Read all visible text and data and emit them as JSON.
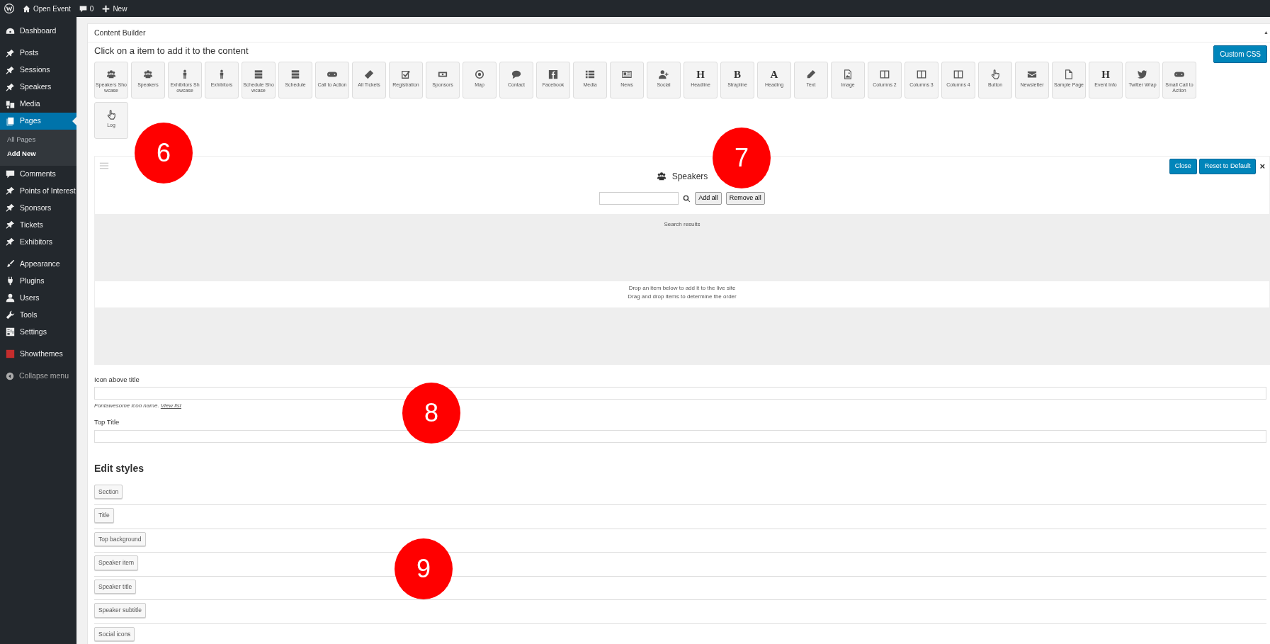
{
  "admin_bar": {
    "site": "Open Event",
    "comments": "0",
    "new": "New"
  },
  "sidebar": {
    "groups": [
      {
        "items": [
          {
            "label": "Dashboard",
            "selected": false
          }
        ]
      },
      {
        "items": [
          {
            "label": "Posts",
            "selected": false
          },
          {
            "label": "Sessions",
            "selected": false
          },
          {
            "label": "Speakers",
            "selected": false
          },
          {
            "label": "Media",
            "selected": false
          },
          {
            "label": "Pages",
            "selected": true,
            "children": [
              {
                "label": "All Pages",
                "selected": false
              },
              {
                "label": "Add New",
                "selected": true
              }
            ]
          },
          {
            "label": "Comments",
            "selected": false
          },
          {
            "label": "Points of Interest",
            "selected": false
          },
          {
            "label": "Sponsors",
            "selected": false
          },
          {
            "label": "Tickets",
            "selected": false
          },
          {
            "label": "Exhibitors",
            "selected": false
          }
        ]
      },
      {
        "items": [
          {
            "label": "Appearance",
            "selected": false
          },
          {
            "label": "Plugins",
            "selected": false
          },
          {
            "label": "Users",
            "selected": false
          },
          {
            "label": "Tools",
            "selected": false
          },
          {
            "label": "Settings",
            "selected": false
          }
        ]
      },
      {
        "items": [
          {
            "label": "Showthemes",
            "selected": false
          }
        ]
      }
    ],
    "collapse": "Collapse menu"
  },
  "content_builder": {
    "title": "Content Builder",
    "toggle": "▲",
    "instruction": "Click on a item to add it to the content",
    "custom_css": "Custom CSS",
    "items": [
      {
        "label": "Speakers Showcase"
      },
      {
        "label": "Speakers"
      },
      {
        "label": "Exhibitors Showcase"
      },
      {
        "label": "Exhibitors"
      },
      {
        "label": "Schedule Showcase"
      },
      {
        "label": "Schedule"
      },
      {
        "label": "Call to Action"
      },
      {
        "label": "All Tickets"
      },
      {
        "label": "Registration"
      },
      {
        "label": "Sponsors"
      },
      {
        "label": "Map"
      },
      {
        "label": "Contact"
      },
      {
        "label": "Facebook"
      },
      {
        "label": "Media"
      },
      {
        "label": "News"
      },
      {
        "label": "Social"
      },
      {
        "label": "Headline",
        "glyph": "H"
      },
      {
        "label": "Strapline",
        "glyph": "B"
      },
      {
        "label": "Heading",
        "glyph": "A"
      },
      {
        "label": "Text"
      },
      {
        "label": "Image"
      },
      {
        "label": "Columns 2"
      },
      {
        "label": "Columns 3"
      },
      {
        "label": "Columns 4"
      },
      {
        "label": "Button"
      },
      {
        "label": "Newsletter"
      },
      {
        "label": "Sample Page"
      },
      {
        "label": "Event Info",
        "glyph": "H"
      },
      {
        "label": "Twitter Wrap"
      },
      {
        "label": "Small Call to Action"
      },
      {
        "label": "Log"
      }
    ]
  },
  "panel": {
    "title": "Speakers",
    "close": "Close",
    "reset": "Reset to Default",
    "remove": "×",
    "add_all": "Add all",
    "remove_all": "Remove all",
    "results_label": "Search results",
    "drop_hint": [
      "Drop an item below to add it to the live site",
      "Drag and drop items to determine the order"
    ]
  },
  "fields": [
    {
      "label": "Icon above title",
      "hint": "Fontawesome icon name.",
      "link": "View list"
    },
    {
      "label": "Top Title"
    }
  ],
  "edit_styles": {
    "title": "Edit styles",
    "buttons": [
      "Section",
      "Title",
      "Top background",
      "Speaker item",
      "Speaker title",
      "Speaker subtitle",
      "Social icons"
    ]
  },
  "callouts": [
    "6",
    "7",
    "8",
    "9"
  ]
}
